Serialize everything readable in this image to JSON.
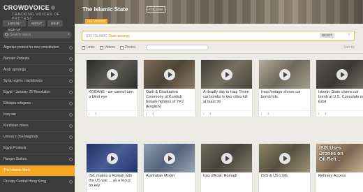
{
  "brand": {
    "name": "CROWDVOICE",
    "tagline": "TRACKING VOICES OF PROTEST"
  },
  "nav_buttons": [
    "LOG IN / SIGN UP",
    "ABOUT",
    "HELP"
  ],
  "sidebar_search": {
    "placeholder": "Search topics"
  },
  "topics": [
    {
      "label": "Algerian protest for new constitution"
    },
    {
      "label": "Bahrain Protests"
    },
    {
      "label": "Arab uprisings"
    },
    {
      "label": "Syria regime crackdowns"
    },
    {
      "label": "Egypt - January 25 Revolution"
    },
    {
      "label": "Ethiopia refugees"
    },
    {
      "label": "Iraq war"
    },
    {
      "label": "Kurdistan crises"
    },
    {
      "label": "Unrest in the Maghreb"
    },
    {
      "label": "Egypt Protests"
    },
    {
      "label": "Hunger Strikes"
    },
    {
      "label": "The Islamic State",
      "active": true
    },
    {
      "label": "Occupy Central Hong Kong"
    }
  ],
  "header": {
    "title": "The Islamic State",
    "follow": "FOLLOW",
    "tab": "ALL VOICES"
  },
  "search": {
    "prefix": "ISIS ISLAMIC",
    "highlight": "State strategy",
    "reset": "RESET",
    "close": "×"
  },
  "filters": {
    "links": "Links",
    "videos": "Videos",
    "photos": "Photos",
    "sort": "Sort by"
  },
  "cards": [
    {
      "caption": "KOBANE - we cannot turn a blind eye",
      "color": "#3b3b35"
    },
    {
      "caption": "Oath & Graduation Ceremony of Kurdish female fighters of YPJ (English)",
      "color": "#6b5d4c"
    },
    {
      "caption": "A deadly day in Iraq: Three car bombs in two cities kill at least 30",
      "color": "#5a5448"
    },
    {
      "caption": "Iraqi footage shows car bomb hits",
      "color": "#8a8476"
    },
    {
      "caption": "Islamic State claims car bomb at U.S. Consulate in Erbil",
      "color": "#4f4b44"
    },
    {
      "caption": "ISIL makes a Rumah with the US war ... as a focus on key",
      "color": "#2e3d6b"
    },
    {
      "caption": "Australian Model",
      "color": "#6a7b8f"
    },
    {
      "caption": "Iraq official: Ramadi",
      "color": "#5d5a4e"
    },
    {
      "caption": "ISIS & US LIVE",
      "color": "#6e6855"
    },
    {
      "caption": "Refinery Access",
      "color": "#a18a70"
    }
  ],
  "share": {
    "twitter": "t",
    "facebook": "f"
  },
  "video_overlays": {
    "c10_l1": "ISIS Uses",
    "c10_l2": "Drones on",
    "c10_l3": "Oil Refi..."
  },
  "colors": {
    "accent": "#f5a623",
    "sidebar": "#3b3b3b"
  }
}
